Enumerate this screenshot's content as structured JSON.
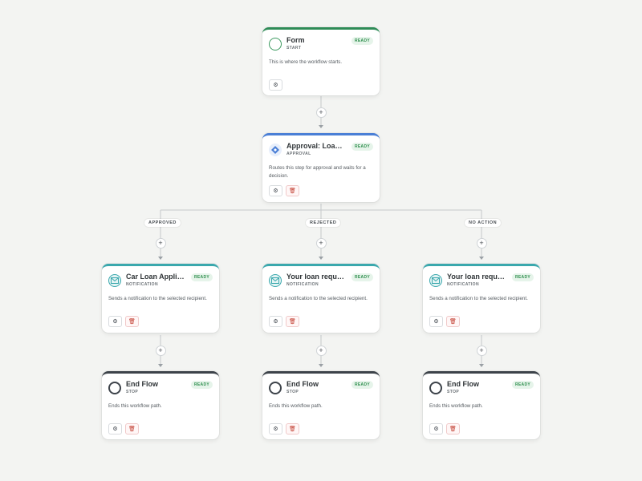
{
  "nodes": {
    "form": {
      "title": "Form",
      "type": "START",
      "status": "READY",
      "description": "This is where the workflow starts."
    },
    "approval": {
      "title": "Approval: Loan ...",
      "type": "APPROVAL",
      "status": "READY",
      "description": "Routes this step for approval and waits for a decision."
    },
    "notify_approved": {
      "title": "Car Loan Applic...",
      "type": "NOTIFICATION",
      "status": "READY",
      "description": "Sends a notification to the selected recipient."
    },
    "notify_rejected": {
      "title": "Your loan reque...",
      "type": "NOTIFICATION",
      "status": "READY",
      "description": "Sends a notification to the selected recipient."
    },
    "notify_no_action": {
      "title": "Your loan reque...",
      "type": "NOTIFICATION",
      "status": "READY",
      "description": "Sends a notification to the selected recipient."
    },
    "end_approved": {
      "title": "End Flow",
      "type": "STOP",
      "status": "READY",
      "description": "Ends this workflow path."
    },
    "end_rejected": {
      "title": "End Flow",
      "type": "STOP",
      "status": "READY",
      "description": "Ends this workflow path."
    },
    "end_no_action": {
      "title": "End Flow",
      "type": "STOP",
      "status": "READY",
      "description": "Ends this workflow path."
    }
  },
  "branches": {
    "approved": "APPROVED",
    "rejected": "REJECTED",
    "no_action": "NO ACTION"
  },
  "controls": {
    "add_step": "+",
    "settings_icon": "gear-icon",
    "delete_icon": "trash-icon"
  },
  "colors": {
    "background": "#f3f4f2",
    "start_accent": "#2e8b57",
    "approval_accent": "#4a7fd6",
    "notification_accent": "#3aa8ad",
    "stop_accent": "#3d434a",
    "ready_badge": "#2f8f4e"
  }
}
